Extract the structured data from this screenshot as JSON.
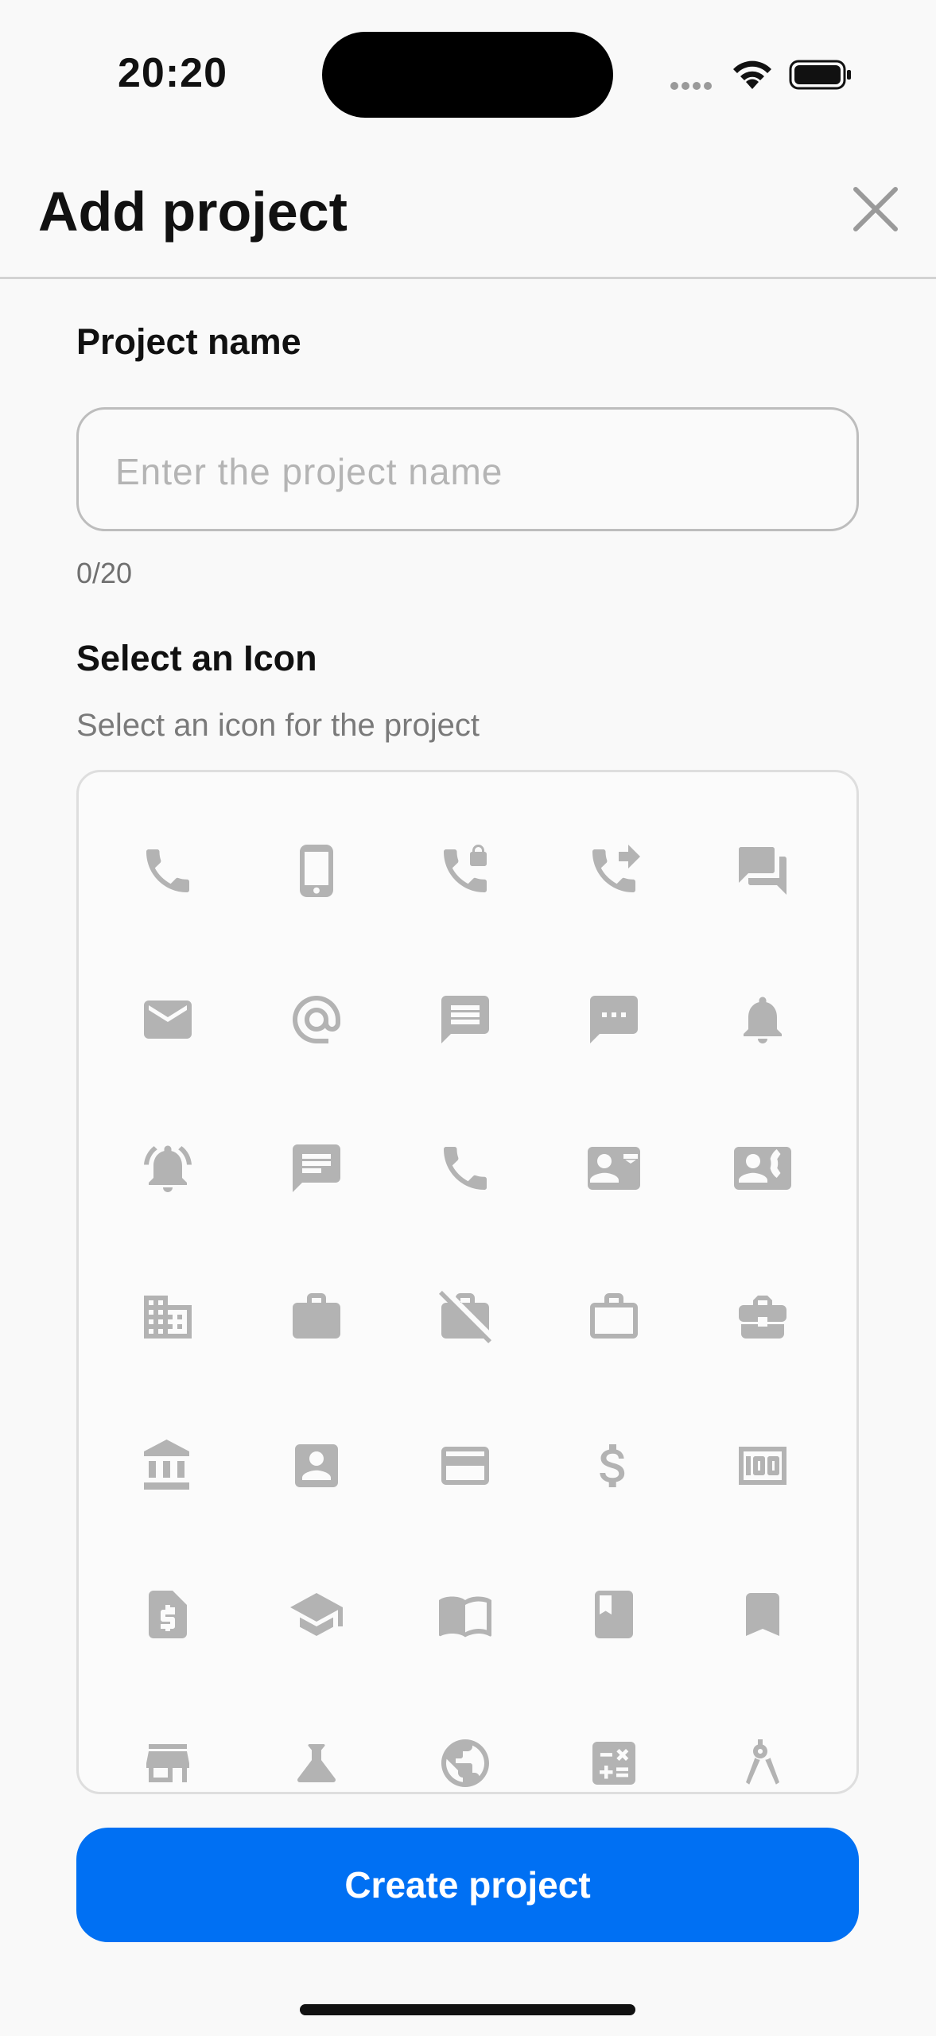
{
  "status_bar": {
    "time": "20:20"
  },
  "header": {
    "title": "Add project"
  },
  "project_name": {
    "label": "Project name",
    "placeholder": "Enter the project name",
    "value": "",
    "counter": "0/20"
  },
  "icon_section": {
    "label": "Select an Icon",
    "subtitle": "Select an icon for the project",
    "icons": [
      "phone-icon",
      "smartphone-icon",
      "phone-locked-icon",
      "phone-forwarded-icon",
      "forum-icon",
      "email-icon",
      "at-sign-icon",
      "message-icon",
      "sms-icon",
      "notification-icon",
      "notifications-active-icon",
      "chat-icon",
      "call-icon",
      "contact-mail-icon",
      "contact-phone-icon",
      "business-icon",
      "work-icon",
      "work-off-icon",
      "work-outline-icon",
      "business-center-icon",
      "bank-icon",
      "account-box-icon",
      "credit-card-icon",
      "dollar-icon",
      "money-icon",
      "request-quote-icon",
      "school-icon",
      "book-open-icon",
      "book-icon",
      "bookmark-icon",
      "store-icon",
      "science-icon",
      "public-icon",
      "calculate-icon",
      "architecture-icon"
    ]
  },
  "actions": {
    "create_label": "Create project"
  },
  "colors": {
    "accent": "#0070f3",
    "icon": "#b3b3b3",
    "background": "#f9f9f9"
  }
}
